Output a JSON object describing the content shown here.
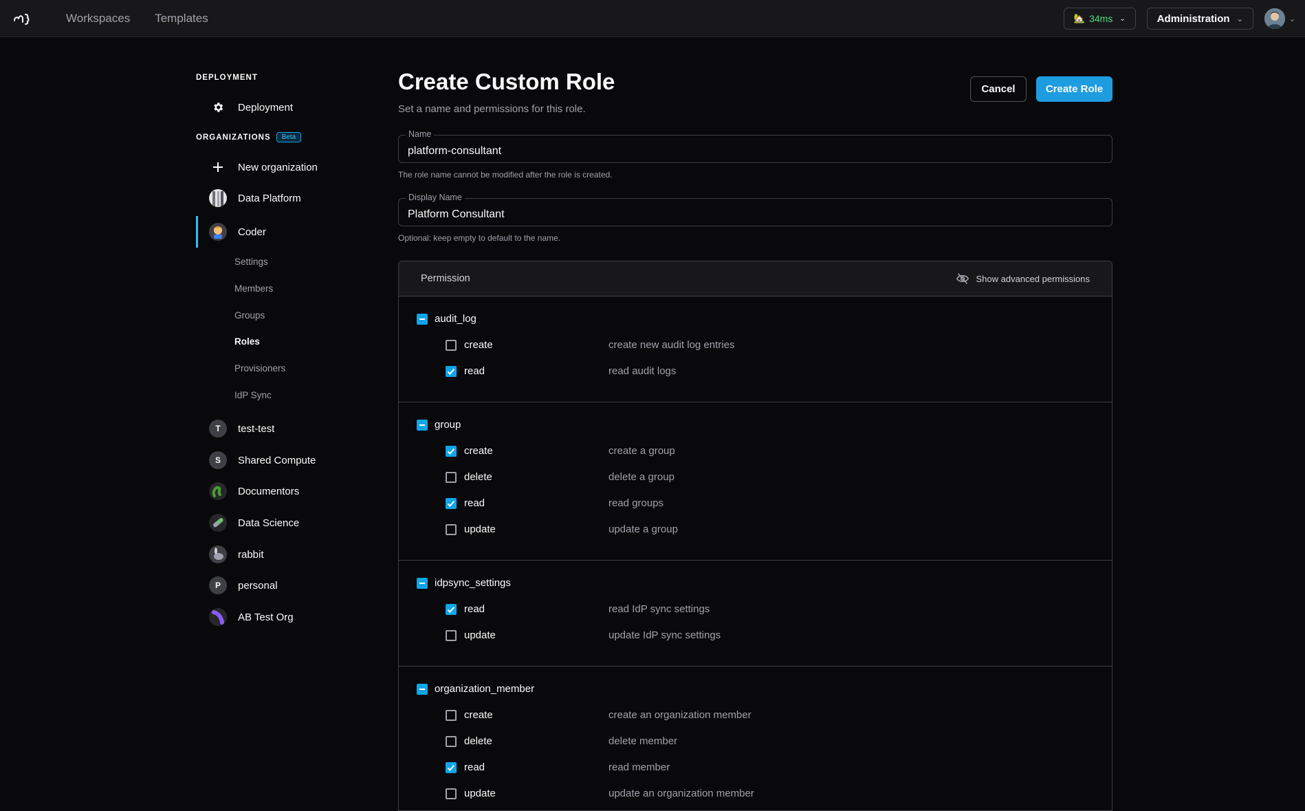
{
  "topbar": {
    "nav": [
      "Workspaces",
      "Templates"
    ],
    "latency": "34ms",
    "admin_label": "Administration"
  },
  "sidebar": {
    "deployment_heading": "DEPLOYMENT",
    "deployment_item": "Deployment",
    "organizations_heading": "ORGANIZATIONS",
    "beta": "Beta",
    "new_org": "New organization",
    "orgs": [
      {
        "label": "Data Platform",
        "icon": "data-platform-avatar"
      },
      {
        "label": "Coder",
        "icon": "coder-avatar"
      },
      {
        "label": "test-test",
        "letter": "T"
      },
      {
        "label": "Shared Compute",
        "letter": "S"
      },
      {
        "label": "Documentors",
        "icon": "documentors-avatar"
      },
      {
        "label": "Data Science",
        "icon": "data-science-avatar"
      },
      {
        "label": "rabbit",
        "icon": "rabbit-avatar"
      },
      {
        "label": "personal",
        "letter": "P"
      },
      {
        "label": "AB Test Org",
        "icon": "ab-test-avatar"
      }
    ],
    "coder_sub": [
      "Settings",
      "Members",
      "Groups",
      "Roles",
      "Provisioners",
      "IdP Sync"
    ]
  },
  "main": {
    "title": "Create Custom Role",
    "subtitle": "Set a name and permissions for this role.",
    "cancel": "Cancel",
    "create": "Create Role",
    "name_label": "Name",
    "name_value": "platform-consultant",
    "name_helper": "The role name cannot be modified after the role is created.",
    "display_label": "Display Name",
    "display_value": "Platform Consultant",
    "display_helper": "Optional: keep empty to default to the name."
  },
  "permissions": {
    "header": "Permission",
    "advanced": "Show advanced permissions",
    "groups": [
      {
        "name": "audit_log",
        "actions": [
          {
            "name": "create",
            "desc": "create new audit log entries",
            "checked": false
          },
          {
            "name": "read",
            "desc": "read audit logs",
            "checked": true
          }
        ]
      },
      {
        "name": "group",
        "actions": [
          {
            "name": "create",
            "desc": "create a group",
            "checked": true
          },
          {
            "name": "delete",
            "desc": "delete a group",
            "checked": false
          },
          {
            "name": "read",
            "desc": "read groups",
            "checked": true
          },
          {
            "name": "update",
            "desc": "update a group",
            "checked": false
          }
        ]
      },
      {
        "name": "idpsync_settings",
        "actions": [
          {
            "name": "read",
            "desc": "read IdP sync settings",
            "checked": true
          },
          {
            "name": "update",
            "desc": "update IdP sync settings",
            "checked": false
          }
        ]
      },
      {
        "name": "organization_member",
        "actions": [
          {
            "name": "create",
            "desc": "create an organization member",
            "checked": false
          },
          {
            "name": "delete",
            "desc": "delete member",
            "checked": false
          },
          {
            "name": "read",
            "desc": "read member",
            "checked": true
          },
          {
            "name": "update",
            "desc": "update an organization member",
            "checked": false
          }
        ]
      }
    ]
  },
  "colors": {
    "accent": "#0ea5e9",
    "background": "#09090b",
    "latency": "#4ade80"
  }
}
